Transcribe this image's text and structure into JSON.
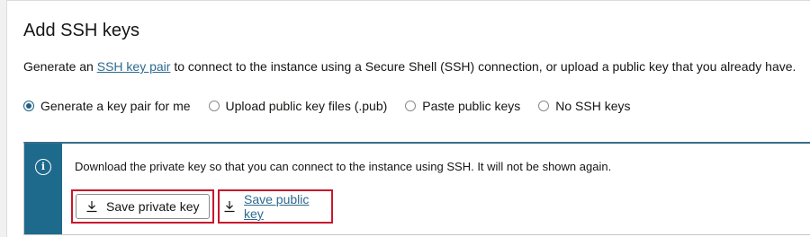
{
  "section": {
    "title": "Add SSH keys",
    "description_prefix": "Generate an ",
    "description_link": "SSH key pair",
    "description_suffix": " to connect to the instance using a Secure Shell (SSH) connection, or upload a public key that you already have."
  },
  "options": [
    {
      "label": "Generate a key pair for me",
      "selected": true
    },
    {
      "label": "Upload public key files (.pub)",
      "selected": false
    },
    {
      "label": "Paste public keys",
      "selected": false
    },
    {
      "label": "No SSH keys",
      "selected": false
    }
  ],
  "info": {
    "icon": "info-icon",
    "message": "Download the private key so that you can connect to the instance using SSH. It will not be shown again."
  },
  "actions": {
    "save_private_key": "Save private key",
    "save_public_key": "Save public key",
    "icon": "download-icon"
  },
  "colors": {
    "accent": "#1e6a8d",
    "link": "#2c6a8f",
    "highlight": "#c8182c"
  }
}
